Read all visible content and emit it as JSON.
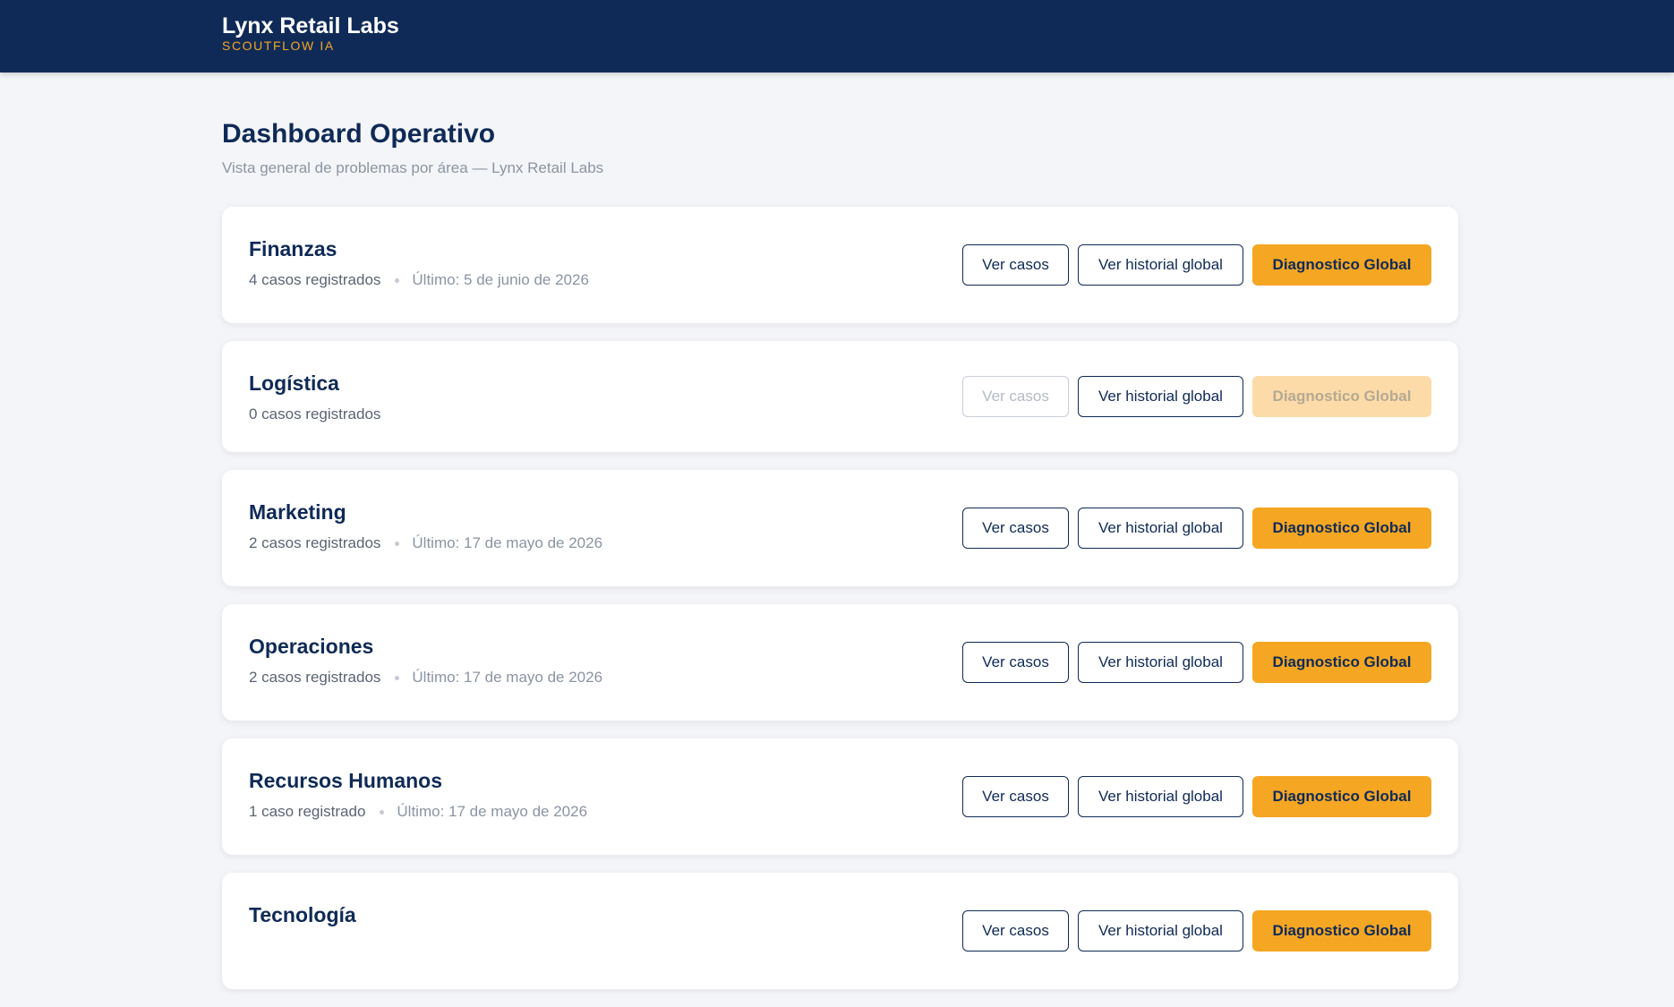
{
  "header": {
    "brand_name": "Lynx Retail Labs",
    "brand_sub": "SCOUTFLOW IA",
    "background_color": "#0f2a57",
    "accent_color": "#f5a623"
  },
  "page": {
    "title": "Dashboard Operativo",
    "subtitle": "Vista general de problemas por área — Lynx Retail Labs"
  },
  "buttons": {
    "cases_label": "Ver casos",
    "history_label": "Ver historial global",
    "diagnostic_label": "Diagnostico Global"
  },
  "areas": [
    {
      "name": "Finanzas",
      "count": "4 casos registrados",
      "last": "Último: 5 de junio de 2026",
      "enabled": true
    },
    {
      "name": "Logística",
      "count": "0 casos registrados",
      "last": "",
      "enabled": false
    },
    {
      "name": "Marketing",
      "count": "2 casos registrados",
      "last": "Último: 17 de mayo de 2026",
      "enabled": true
    },
    {
      "name": "Operaciones",
      "count": "2 casos registrados",
      "last": "Último: 17 de mayo de 2026",
      "enabled": true
    },
    {
      "name": "Recursos Humanos",
      "count": "1 caso registrado",
      "last": "Último: 17 de mayo de 2026",
      "enabled": true
    },
    {
      "name": "Tecnología",
      "count": "",
      "last": "",
      "enabled": true
    }
  ]
}
